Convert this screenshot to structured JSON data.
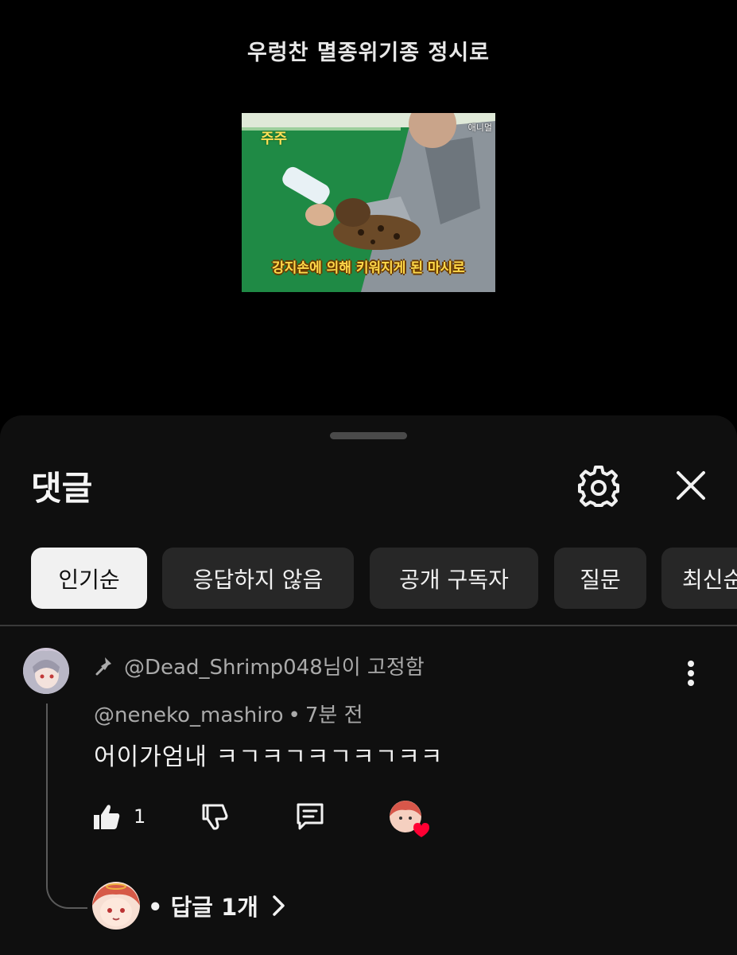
{
  "video": {
    "title": "우렁찬 멸종위기종 정시로",
    "thumb_caption": "강지손에 의해 키워지게 된 마시로",
    "thumb_logo": "주주",
    "thumb_corner": "애니멀"
  },
  "comments_panel": {
    "title": "댓글",
    "settings_icon": "gear-icon",
    "close_icon": "close-icon",
    "filters": [
      {
        "label": "인기순",
        "active": true
      },
      {
        "label": "응답하지 않음",
        "active": false
      },
      {
        "label": "공개 구독자",
        "active": false
      },
      {
        "label": "질문",
        "active": false
      },
      {
        "label": "최신순",
        "active": false
      }
    ]
  },
  "comment": {
    "pinned_by": "@Dead_Shrimp048님이 고정함",
    "author": "@neneko_mashiro",
    "separator": "•",
    "time": "7분 전",
    "text": "어이가엄내 ㅋㄱㅋㄱㅋㄱㅋㄱㅋㅋ",
    "likes": "1",
    "reply_label": "• 답글 1개"
  },
  "colors": {
    "background": "#000000",
    "sheet": "#0f0f0f",
    "chip": "#272727",
    "chip_active": "#f1f1f1",
    "heart": "#ff0033"
  }
}
